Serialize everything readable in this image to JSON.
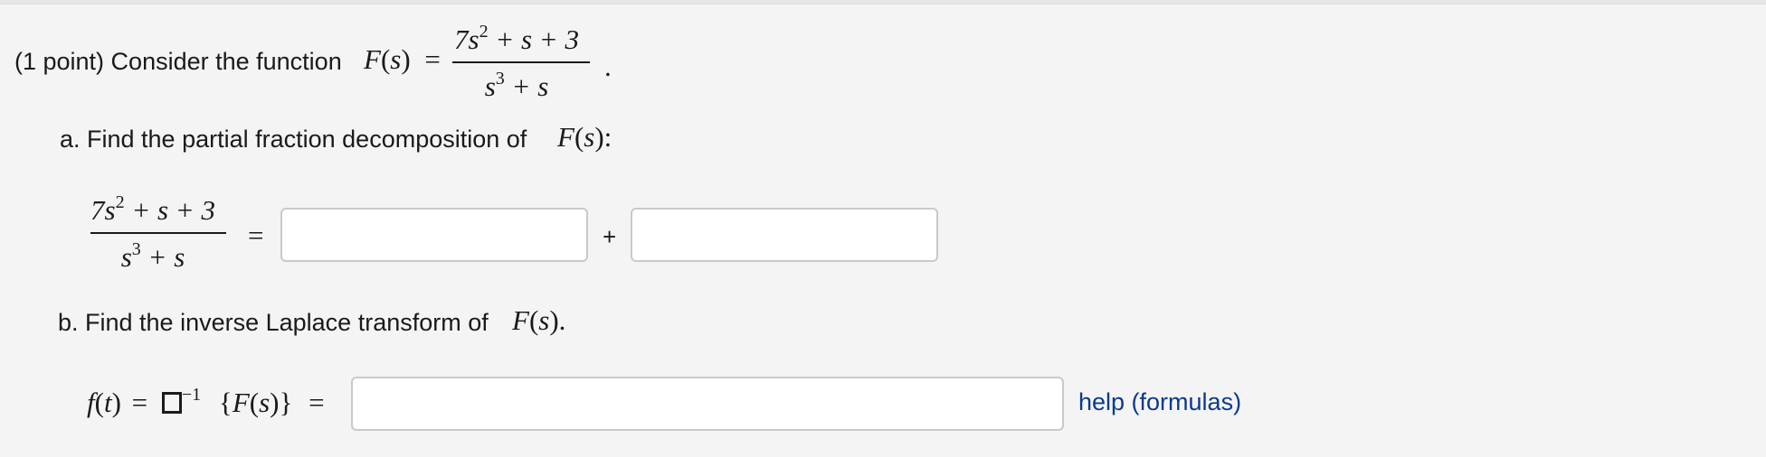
{
  "problem": {
    "intro": "(1 point) Consider the function",
    "func_name": "F",
    "var": "s",
    "numerator_lead": "7s",
    "numerator_exp": "2",
    "numerator_rest": " + s + 3",
    "denominator_lead": "s",
    "denominator_exp": "3",
    "denominator_rest": " + s",
    "equals": "=",
    "period": "."
  },
  "part_a": {
    "prompt": "a. Find the partial fraction decomposition of",
    "suffix": ":",
    "plus": "+",
    "answer1_value": "",
    "answer2_value": ""
  },
  "part_b": {
    "prompt": "b. Find the inverse Laplace transform of",
    "suffix": ".",
    "lhs_f": "f",
    "lhs_t": "t",
    "inverse_exp": "−1",
    "brace_open": "{",
    "brace_close": "}",
    "answer_value": "",
    "help_link": "help (formulas)"
  }
}
